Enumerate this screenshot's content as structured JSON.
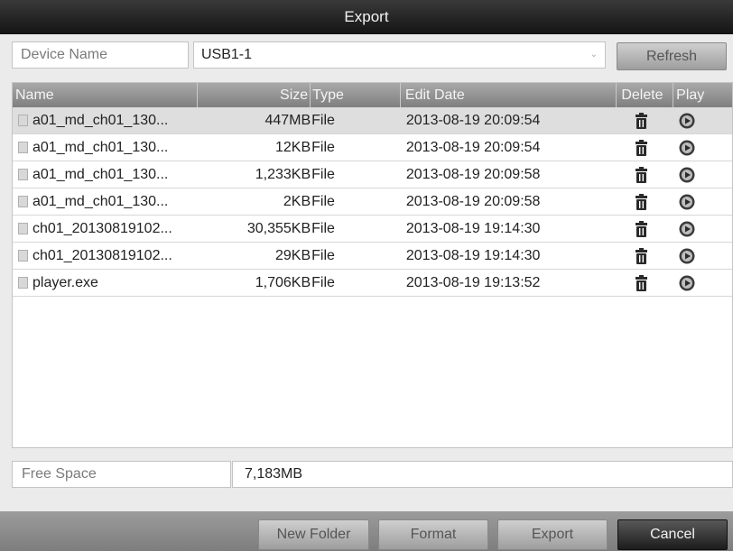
{
  "title": "Export",
  "device": {
    "label": "Device Name",
    "value": "USB1-1",
    "refresh_label": "Refresh"
  },
  "table": {
    "headers": {
      "name": "Name",
      "size": "Size",
      "type": "Type",
      "date": "Edit Date",
      "delete": "Delete",
      "play": "Play"
    },
    "rows": [
      {
        "name": "a01_md_ch01_130...",
        "size": "447MB",
        "type": "File",
        "date": "2013-08-19 20:09:54"
      },
      {
        "name": "a01_md_ch01_130...",
        "size": "12KB",
        "type": "File",
        "date": "2013-08-19 20:09:54"
      },
      {
        "name": "a01_md_ch01_130...",
        "size": "1,233KB",
        "type": "File",
        "date": "2013-08-19 20:09:58"
      },
      {
        "name": "a01_md_ch01_130...",
        "size": "2KB",
        "type": "File",
        "date": "2013-08-19 20:09:58"
      },
      {
        "name": "ch01_20130819102...",
        "size": "30,355KB",
        "type": "File",
        "date": "2013-08-19 19:14:30"
      },
      {
        "name": "ch01_20130819102...",
        "size": "29KB",
        "type": "File",
        "date": "2013-08-19 19:14:30"
      },
      {
        "name": "player.exe",
        "size": "1,706KB",
        "type": "File",
        "date": "2013-08-19 19:13:52"
      }
    ],
    "selected_row": 0
  },
  "free_space": {
    "label": "Free Space",
    "value": "7,183MB"
  },
  "buttons": {
    "new_folder": "New Folder",
    "format": "Format",
    "export": "Export",
    "cancel": "Cancel"
  },
  "icons": {
    "delete": "trash-icon",
    "play": "play-icon",
    "file": "file-icon"
  }
}
